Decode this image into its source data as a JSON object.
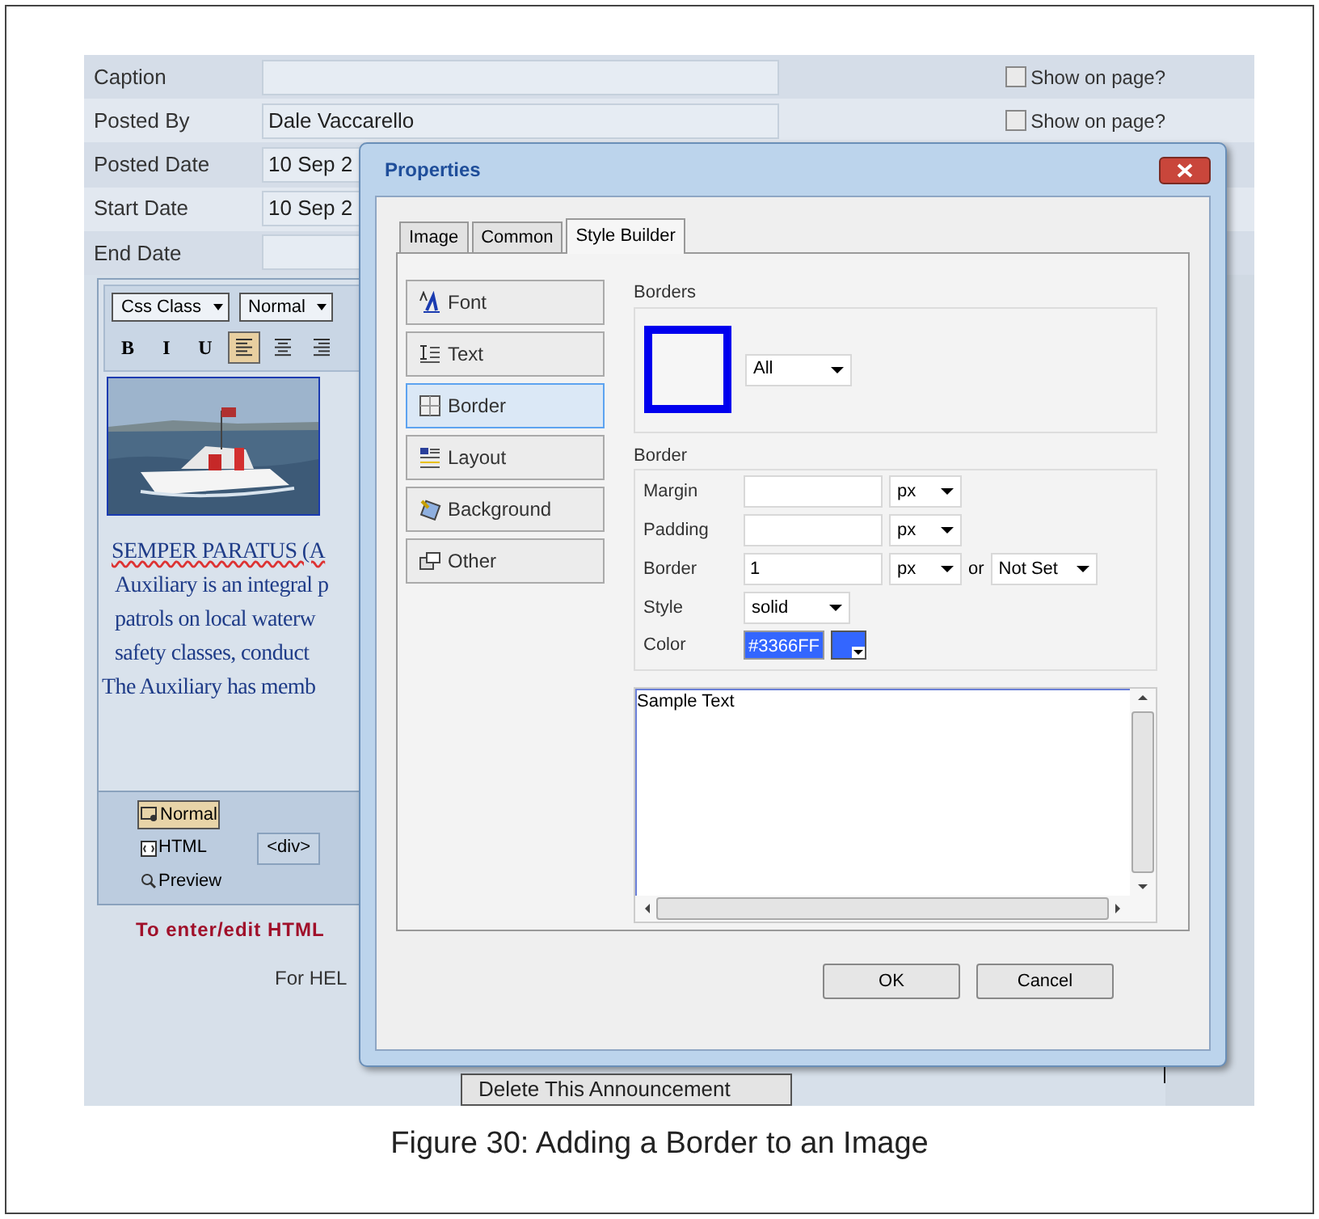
{
  "form": {
    "rows": [
      {
        "label": "Caption",
        "show_on_page": {
          "label": "Show on page?",
          "checked": false
        }
      },
      {
        "label": "Posted By",
        "value": "Dale Vaccarello",
        "show_on_page": {
          "label": "Show on page?",
          "checked": false
        }
      },
      {
        "label": "Posted Date",
        "value": "10 Sep 2"
      },
      {
        "label": "Start Date",
        "value": "10 Sep 2"
      },
      {
        "label": "End Date"
      }
    ]
  },
  "editor": {
    "selects": [
      "Css Class",
      "Normal"
    ],
    "format_buttons": [
      {
        "kind": "text",
        "label": "B",
        "selected": false
      },
      {
        "kind": "text",
        "label": "I",
        "selected": false
      },
      {
        "kind": "text",
        "label": "U",
        "selected": false
      },
      {
        "kind": "align-left",
        "selected": true
      },
      {
        "kind": "align-center",
        "selected": false
      },
      {
        "kind": "align-right",
        "selected": false
      }
    ],
    "image": {
      "kind": "picture",
      "selected": true
    },
    "content_lines": [
      "SEMPER PARATUS (A",
      "Auxiliary is an integral p",
      "patrols on local waterw",
      "safety classes, conduct",
      "The Auxiliary has memb"
    ],
    "modes": [
      {
        "kind": "design",
        "label": "Normal",
        "selected": true
      },
      {
        "kind": "html",
        "label": "HTML",
        "selected": false
      },
      {
        "kind": "preview",
        "label": "Preview",
        "selected": false
      }
    ],
    "tag_path": [
      "<div>"
    ]
  },
  "notice": "To enter/edit HTML",
  "help": "For HEL",
  "delete_button": "Delete This Announcement",
  "dialog": {
    "title": "Properties",
    "tabs": [
      {
        "label": "Image",
        "selected": false
      },
      {
        "label": "Common",
        "selected": false
      },
      {
        "label": "Style Builder",
        "selected": true
      }
    ],
    "categories": [
      {
        "kind": "font",
        "label": "Font",
        "selected": false
      },
      {
        "kind": "text",
        "label": "Text",
        "selected": false
      },
      {
        "kind": "border",
        "label": "Border",
        "selected": true
      },
      {
        "kind": "layout",
        "label": "Layout",
        "selected": false
      },
      {
        "kind": "background",
        "label": "Background",
        "selected": false
      },
      {
        "kind": "other",
        "label": "Other",
        "selected": false
      }
    ],
    "borders": {
      "title": "Borders",
      "side": "All"
    },
    "border": {
      "title": "Border",
      "margin": {
        "label": "Margin",
        "unit": "px"
      },
      "padding": {
        "label": "Padding",
        "unit": "px"
      },
      "width": {
        "label": "Border",
        "value": "1",
        "unit": "px",
        "joiner": "or",
        "preset": "Not Set"
      },
      "style": {
        "label": "Style",
        "value": "solid"
      },
      "color": {
        "label": "Color",
        "value": "#3366FF"
      }
    },
    "sample_text": "Sample Text",
    "buttons": [
      "OK",
      "Cancel"
    ]
  },
  "caption": "Figure 30: Adding a Border to an Image"
}
